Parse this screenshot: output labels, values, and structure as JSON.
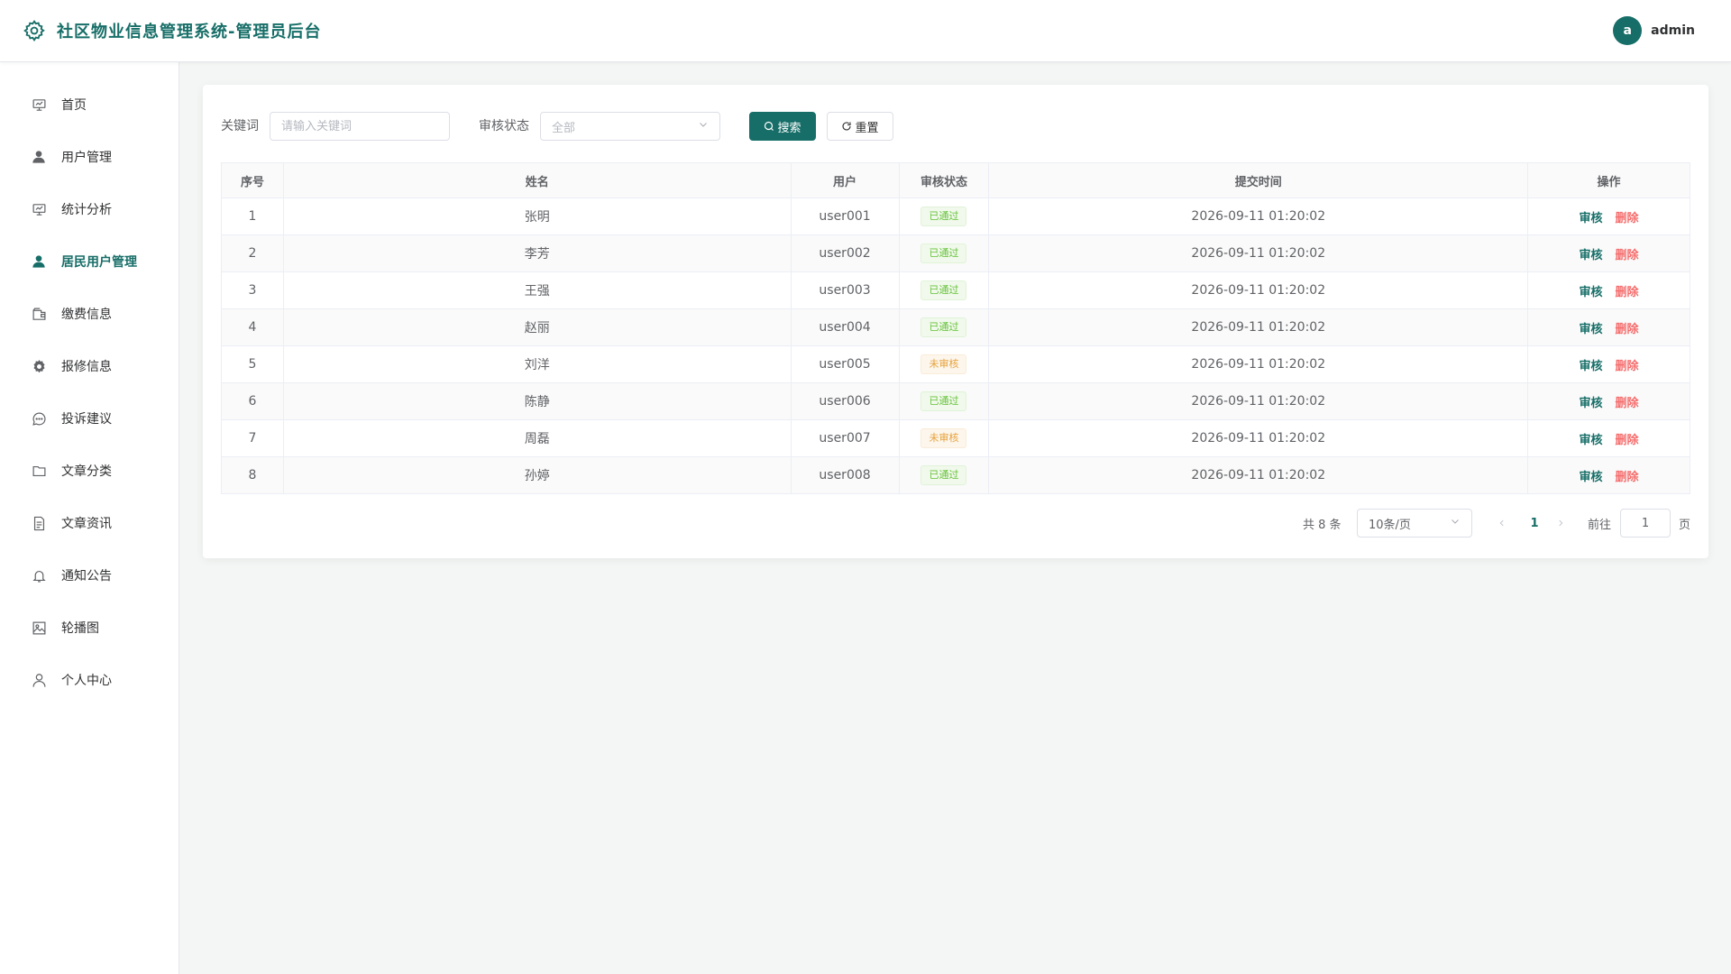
{
  "header": {
    "title": "社区物业信息管理系统-管理员后台",
    "avatar_letter": "a",
    "username": "admin"
  },
  "sidebar": {
    "items": [
      {
        "label": "首页",
        "icon": "home-board-icon"
      },
      {
        "label": "用户管理",
        "icon": "user-filled-icon"
      },
      {
        "label": "统计分析",
        "icon": "chart-board-icon"
      },
      {
        "label": "居民用户管理",
        "icon": "user-filled-icon",
        "active": true
      },
      {
        "label": "缴费信息",
        "icon": "wallet-icon"
      },
      {
        "label": "报修信息",
        "icon": "gear-icon"
      },
      {
        "label": "投诉建议",
        "icon": "chat-icon"
      },
      {
        "label": "文章分类",
        "icon": "folder-icon"
      },
      {
        "label": "文章资讯",
        "icon": "document-icon"
      },
      {
        "label": "通知公告",
        "icon": "bell-icon"
      },
      {
        "label": "轮播图",
        "icon": "picture-icon"
      },
      {
        "label": "个人中心",
        "icon": "user-outline-icon"
      }
    ]
  },
  "filters": {
    "keyword_label": "关键词",
    "keyword_placeholder": "请输入关键词",
    "status_label": "审核状态",
    "status_value": "全部",
    "search_label": "搜索",
    "reset_label": "重置"
  },
  "table": {
    "headers": [
      "序号",
      "姓名",
      "用户",
      "审核状态",
      "提交时间",
      "操作"
    ],
    "rows": [
      {
        "index": "1",
        "name": "张明",
        "user": "user001",
        "status": "已通过",
        "time": "2026-09-11 01:20:02"
      },
      {
        "index": "2",
        "name": "李芳",
        "user": "user002",
        "status": "已通过",
        "time": "2026-09-11 01:20:02"
      },
      {
        "index": "3",
        "name": "王强",
        "user": "user003",
        "status": "已通过",
        "time": "2026-09-11 01:20:02"
      },
      {
        "index": "4",
        "name": "赵丽",
        "user": "user004",
        "status": "已通过",
        "time": "2026-09-11 01:20:02"
      },
      {
        "index": "5",
        "name": "刘洋",
        "user": "user005",
        "status": "未审核",
        "time": "2026-09-11 01:20:02"
      },
      {
        "index": "6",
        "name": "陈静",
        "user": "user006",
        "status": "已通过",
        "time": "2026-09-11 01:20:02"
      },
      {
        "index": "7",
        "name": "周磊",
        "user": "user007",
        "status": "未审核",
        "time": "2026-09-11 01:20:02"
      },
      {
        "index": "8",
        "name": "孙婷",
        "user": "user008",
        "status": "已通过",
        "time": "2026-09-11 01:20:02"
      }
    ],
    "actions": {
      "audit": "审核",
      "delete": "删除"
    }
  },
  "pagination": {
    "total_text": "共 8 条",
    "page_size": "10条/页",
    "current_page": "1",
    "goto_label": "前往",
    "goto_value": "1",
    "page_suffix": "页"
  },
  "colors": {
    "primary": "#176e68",
    "pass": "#67c23a",
    "pending": "#e6a23c",
    "danger": "#f56c6c"
  }
}
